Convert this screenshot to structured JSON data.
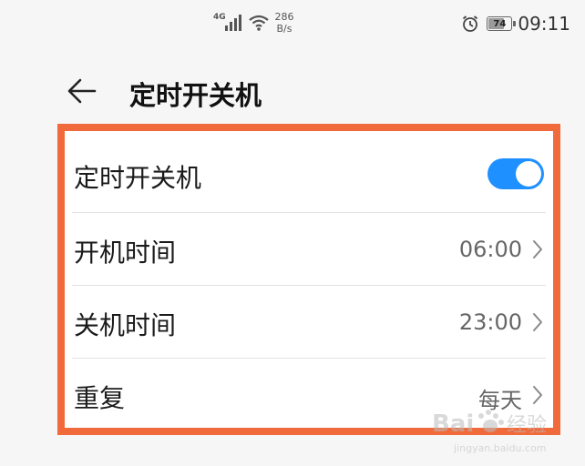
{
  "status_bar": {
    "network_type": "4G",
    "speed_value": "286",
    "speed_unit": "B/s",
    "battery_level": "74",
    "battery_percent": 74,
    "time": "09:11"
  },
  "header": {
    "title": "定时开关机"
  },
  "settings": {
    "toggle_row": {
      "label": "定时开关机",
      "enabled": true
    },
    "power_on": {
      "label": "开机时间",
      "value": "06:00"
    },
    "power_off": {
      "label": "关机时间",
      "value": "23:00"
    },
    "repeat": {
      "label": "重复",
      "value": "每天"
    }
  },
  "colors": {
    "accent": "#1e90ff",
    "highlight_border": "#f06a3c"
  },
  "watermark": {
    "text": "Bai 经验",
    "url_text": "jingyan.baidu.com"
  }
}
